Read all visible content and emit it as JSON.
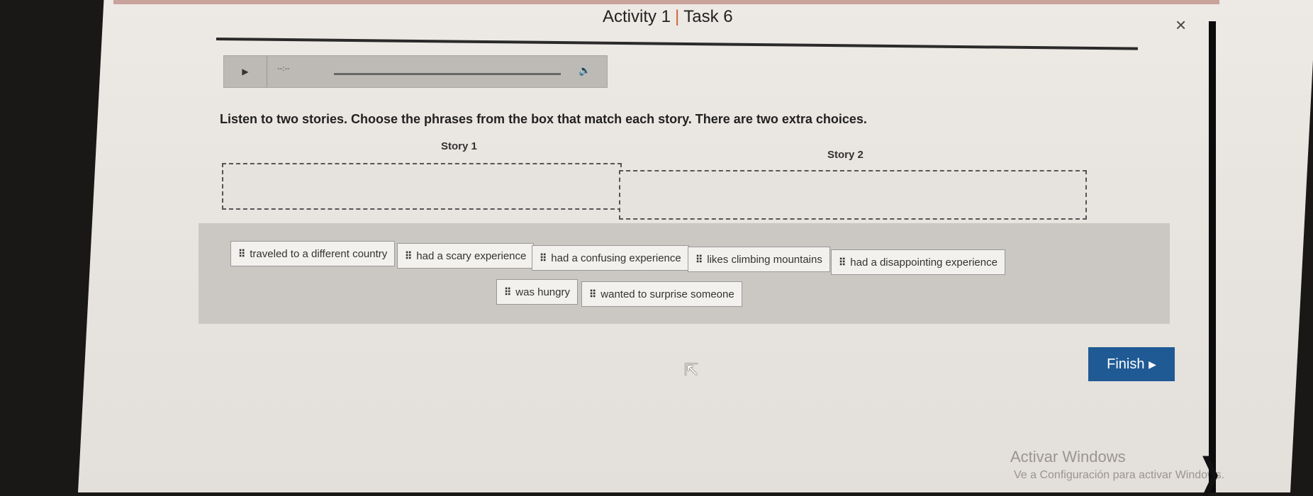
{
  "window": {
    "title_part1": "Activity 1",
    "title_part2": "Task 6",
    "separator": "|",
    "close_label": "×"
  },
  "audio": {
    "play_symbol": "▶",
    "time_text": "--:--",
    "volume_symbol": "🔊"
  },
  "instructions": "Listen to two stories. Choose the phrases from the box that match each story. There are two extra choices.",
  "stories": [
    {
      "header": "Story 1"
    },
    {
      "header": "Story 2"
    }
  ],
  "options": [
    "traveled to a different country",
    "had a scary experience",
    "had a confusing experience",
    "likes climbing mountains",
    "had a disappointing experience",
    "was hungry",
    "wanted to surprise someone"
  ],
  "grip_symbol": "⠿",
  "finish": {
    "label": "Finish",
    "arrow": "▶"
  },
  "watermark": {
    "title": "Activar Windows",
    "subtitle": "Ve a Configuración para activar Windows."
  }
}
